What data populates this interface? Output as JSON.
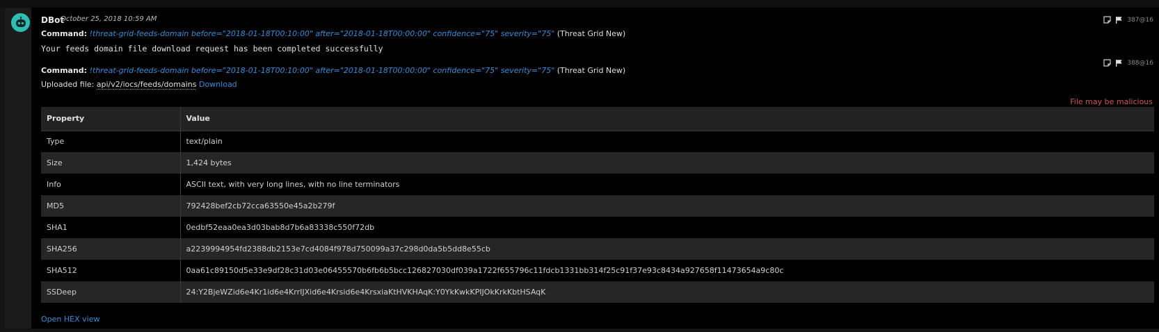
{
  "message": {
    "author": "DBot",
    "date": "October 25, 2018 10:59 AM"
  },
  "entry1": {
    "command_label": "Command:",
    "command": "!threat-grid-feeds-domain before=\"2018-01-18T00:10:00\" after=\"2018-01-18T00:00:00\" confidence=\"75\" severity=\"75\"",
    "integration": "(Threat Grid New)",
    "response": "Your feeds domain file download request has been completed successfully",
    "entry_id": "387@16"
  },
  "entry2": {
    "command_label": "Command:",
    "command": "!threat-grid-feeds-domain before=\"2018-01-18T00:10:00\" after=\"2018-01-18T00:00:00\" confidence=\"75\" severity=\"75\"",
    "integration": "(Threat Grid New)",
    "entry_id": "388@16",
    "uploaded_label": "Uploaded file:",
    "file_path": "api/v2/iocs/feeds/domains",
    "download_label": "Download",
    "warning": "File may be malicious"
  },
  "table": {
    "headers": [
      "Property",
      "Value"
    ],
    "rows": [
      {
        "property": "Type",
        "value": "text/plain"
      },
      {
        "property": "Size",
        "value": "1,424 bytes"
      },
      {
        "property": "Info",
        "value": "ASCII text, with very long lines, with no line terminators"
      },
      {
        "property": "MD5",
        "value": "792428bef2cb72cca63550e45a2b279f"
      },
      {
        "property": "SHA1",
        "value": "0edbf52eaa0ea3d03bab8d7b6a83338c550f72db"
      },
      {
        "property": "SHA256",
        "value": "a2239994954fd2388db2153e7cd4084f978d750099a37c298d0da5b5dd8e55cb"
      },
      {
        "property": "SHA512",
        "value": "0aa61c89150d5e33e9df28c31d03e06455570b6fb6b5bcc126827030df039a1722f655796c11fdcb1331bb314f25c91f37e93c8434a927658f11473654a9c80c"
      },
      {
        "property": "SSDeep",
        "value": "24:Y2BjeWZid6e4Kr1id6e4KrrIJXid6e4Krsid6e4KrsxiaKtHVKHAqK:Y0YkKwkKPIJOkKrkKbtHSAqK"
      }
    ]
  },
  "links": {
    "hex_view": "Open HEX view"
  },
  "colors": {
    "link": "#2f8fdc",
    "warning": "#d9534f",
    "avatar": "#2fbcb3"
  },
  "icons": {
    "note": "note-icon",
    "flag": "flag-icon"
  }
}
